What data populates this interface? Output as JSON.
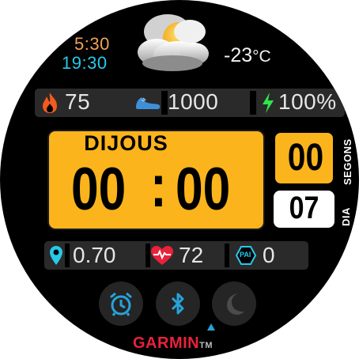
{
  "sun": {
    "sunrise": "5:30",
    "sunset": "19:30"
  },
  "weather": {
    "icon": "partly-cloudy-icon",
    "temperature": "-23",
    "unit": "°C"
  },
  "stats": {
    "calories": {
      "icon": "flame-icon",
      "value": "75"
    },
    "steps": {
      "icon": "shoe-icon",
      "value": "1000"
    },
    "battery": {
      "icon": "lightning-icon",
      "value": "100%"
    }
  },
  "clock": {
    "day_name": "DIJOUS",
    "hours": "00",
    "separator": ":",
    "minutes": "00"
  },
  "seconds": {
    "value": "00",
    "label": "SEGONS"
  },
  "day": {
    "value": "07",
    "label": "DIA"
  },
  "stats2": {
    "distance": {
      "icon": "location-pin-icon",
      "value": "0.70"
    },
    "heart_rate": {
      "icon": "heart-rate-icon",
      "value": "72"
    },
    "pai": {
      "icon": "pai-icon",
      "label": "PAI",
      "value": "0"
    }
  },
  "buttons": [
    {
      "name": "alarm",
      "icon": "alarm-clock-icon"
    },
    {
      "name": "bluetooth",
      "icon": "bluetooth-icon"
    },
    {
      "name": "do-not-disturb",
      "icon": "moon-icon"
    }
  ],
  "brand": {
    "name": "GARMIN",
    "mark": "TM"
  },
  "colors": {
    "accent": "#fbb41b",
    "sunrise": "#f2a154",
    "sunset": "#27c9ea",
    "flame": "#f25a1e",
    "battery": "#2ee64a",
    "heart": "#e8223a",
    "brand": "#e8223a",
    "button_icon": "#27a3d8"
  }
}
